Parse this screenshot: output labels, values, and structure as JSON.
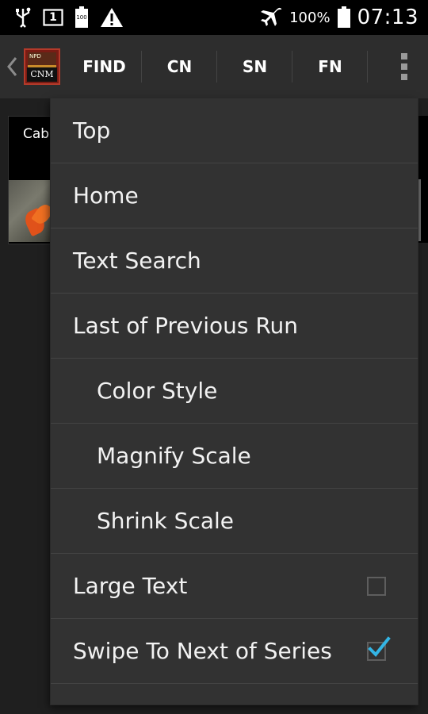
{
  "status_bar": {
    "icons_left": [
      "usb-icon",
      "sim-1-icon",
      "battery-100-icon",
      "warning-icon"
    ],
    "sim_label": "1",
    "battery_mini_label": "100",
    "icons_right": [
      "airplane-icon",
      "battery-icon"
    ],
    "battery_percent": "100%",
    "time": "07:13"
  },
  "action_bar": {
    "back_icon": "chevron-left-icon",
    "logo_text": "CNM",
    "logo_small_text": "NPD",
    "tabs": [
      "FIND",
      "CN",
      "SN",
      "FN"
    ],
    "overflow_icon": "overflow-menu-icon"
  },
  "background": {
    "card_label": "Cab"
  },
  "menu": {
    "items": [
      {
        "label": "Top",
        "indent": 0
      },
      {
        "label": "Home",
        "indent": 0
      },
      {
        "label": "Text Search",
        "indent": 0
      },
      {
        "label": "Last of Previous Run",
        "indent": 0
      },
      {
        "label": "Color Style",
        "indent": 1
      },
      {
        "label": "Magnify Scale",
        "indent": 1
      },
      {
        "label": "Shrink Scale",
        "indent": 1
      },
      {
        "label": "Large Text",
        "indent": 0,
        "checkbox": true,
        "checked": false
      },
      {
        "label": "Swipe To Next of Series",
        "indent": 0,
        "checkbox": true,
        "checked": true
      }
    ],
    "check_color": "#33b5e5"
  }
}
